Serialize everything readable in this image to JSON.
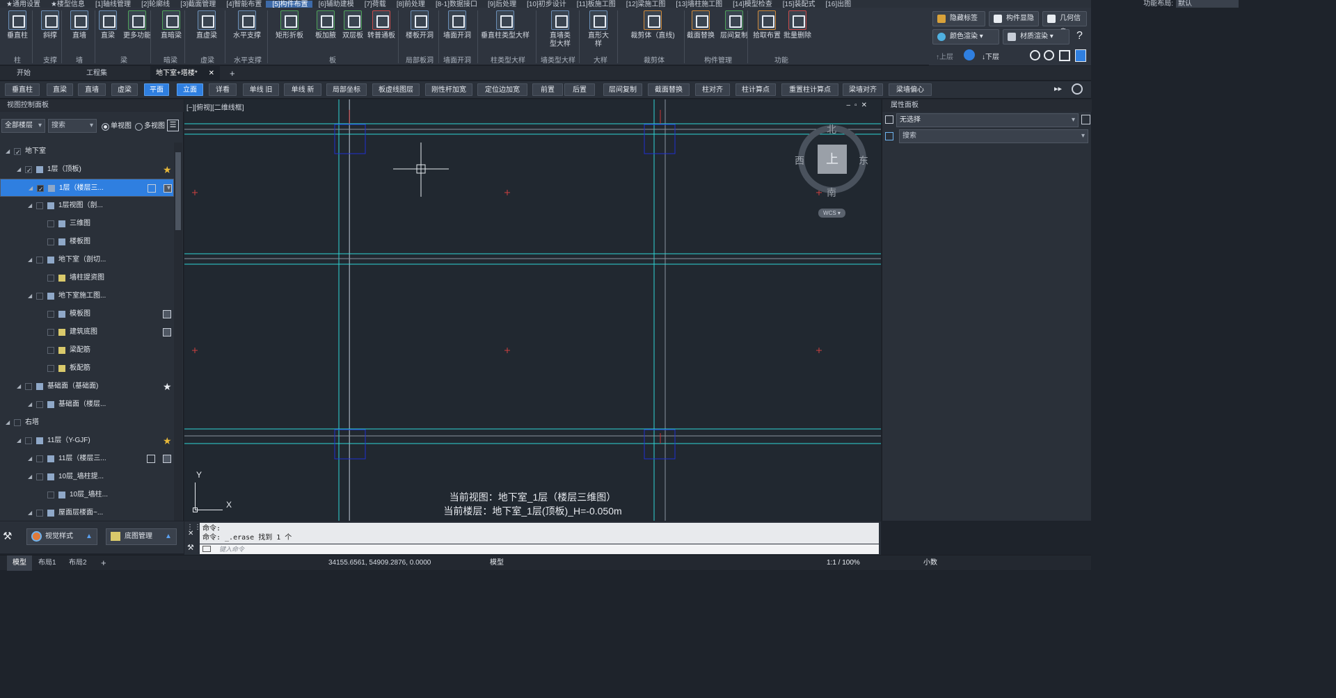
{
  "menu": {
    "items": [
      "★通用设置",
      "★楼型信息",
      "[1]轴线管理",
      "[2]轮廓线",
      "[3]截面管理",
      "[4]智能布置",
      "[5]构件布置",
      "[6]辅助建模",
      "[7]荷载",
      "[8]前处理",
      "[8-1]数据接口",
      "[9]后处理",
      "[10]初步设计",
      "[11]板施工图",
      "[12]梁施工图",
      "[13]墙柱施工图",
      "[14]模型检查",
      "[15]装配式",
      "[16]出图"
    ],
    "active_index": 6,
    "layout_label": "功能布局:",
    "layout_value": "默认"
  },
  "ribbon": {
    "buttons": [
      "垂直柱",
      "斜撑",
      "直墙",
      "直梁",
      "更多功能",
      "直暗梁",
      "直虚梁",
      "水平支撑",
      "矩形折板",
      "板加腋",
      "双层板",
      "转普通板",
      "楼板开洞",
      "墙面开洞",
      "垂直柱类型大样",
      "直墙类型大样",
      "直形大样",
      "裁剪体（直线)",
      "截面替换",
      "层间复制",
      "拾取布置",
      "批量删除"
    ],
    "groups": [
      "柱",
      "支撑",
      "墙",
      "梁",
      "暗梁",
      "虚梁",
      "水平支撑",
      "板",
      "局部板洞",
      "墙面开洞",
      "柱类型大样",
      "墙类型大样",
      "大样",
      "裁剪体",
      "构件管理",
      "功能"
    ]
  },
  "right_ribbon": {
    "hide_tag": "隐藏标签",
    "component_show": "构件显隐",
    "geometry_info": "几何信息",
    "color_render": "颜色渲染",
    "material_render": "材质渲染",
    "floor_up": "上层",
    "floor_down": "下层"
  },
  "tabs": [
    "开始",
    "工程集",
    "地下室+塔楼*"
  ],
  "toolbar": [
    "垂直柱",
    "直梁",
    "直墙",
    "虚梁",
    "平面",
    "立面",
    "详看",
    "单线 旧",
    "单线 新",
    "局部坐标",
    "板虚线图层",
    "刚性杆加宽",
    "定位边加宽",
    "前置",
    "后置",
    "层间复制",
    "截面替换",
    "柱对齐",
    "柱计算点",
    "重置柱计算点",
    "梁墙对齐",
    "梁墙偏心"
  ],
  "left_panel": {
    "title": "视图控制面板",
    "floor_filter": "全部楼层",
    "search_placeholder": "搜索",
    "single_view": "单视图",
    "multi_view": "多视图",
    "tree": [
      {
        "label": "地下室",
        "level": 0
      },
      {
        "label": "1层（顶板)",
        "level": 1
      },
      {
        "label": "1层（楼层三...",
        "level": 2,
        "selected": true
      },
      {
        "label": "1层视图（剖...",
        "level": 2
      },
      {
        "label": "三维图",
        "level": 3
      },
      {
        "label": "楼板图",
        "level": 3
      },
      {
        "label": "地下室（剖切...",
        "level": 2
      },
      {
        "label": "墙柱提资图",
        "level": 3
      },
      {
        "label": "地下室施工图...",
        "level": 2
      },
      {
        "label": "模板图",
        "level": 3
      },
      {
        "label": "建筑底图",
        "level": 3
      },
      {
        "label": "梁配筋",
        "level": 3
      },
      {
        "label": "板配筋",
        "level": 3
      },
      {
        "label": "基础面（基础面)",
        "level": 1
      },
      {
        "label": "基础面（楼层...",
        "level": 2
      },
      {
        "label": "右塔",
        "level": 0
      },
      {
        "label": "11层（Y-GJF)",
        "level": 1
      },
      {
        "label": "11层（楼层三...",
        "level": 2
      },
      {
        "label": "10层_墙柱提...",
        "level": 2
      },
      {
        "label": "10层_墙柱...",
        "level": 3
      },
      {
        "label": "屋面层楼面~...",
        "level": 2
      }
    ],
    "view_style": "视觉样式",
    "base_map": "底图管理"
  },
  "canvas": {
    "view_label": "[−][俯视][二维线框]",
    "compass": {
      "north": "北",
      "south": "南",
      "east": "东",
      "west": "西",
      "top": "上",
      "wcs": "WCS"
    },
    "axis_x": "X",
    "axis_y": "Y",
    "current_view": "当前视图：地下室_1层（楼层三维图）",
    "current_floor": "当前楼层：地下室_1层(顶板)_H=-0.050m"
  },
  "property_panel": {
    "title": "属性面板",
    "selection": "无选择",
    "search_placeholder": "搜索"
  },
  "command": {
    "line1": "命令:",
    "line2": "命令: _.erase 找到 1 个",
    "input_placeholder": "键入命令"
  },
  "bottom": {
    "tabs": [
      "模型",
      "布局1",
      "布局2"
    ],
    "coords": "34155.6561, 54909.2876, 0.0000",
    "mode": "模型",
    "scale": "1:1 / 100%",
    "decimal": "小数"
  },
  "colors": {
    "accent": "#2f7fe0",
    "gridline": "#2fd6d6",
    "column": "#2030d0",
    "axis_mark": "#cc3333"
  }
}
